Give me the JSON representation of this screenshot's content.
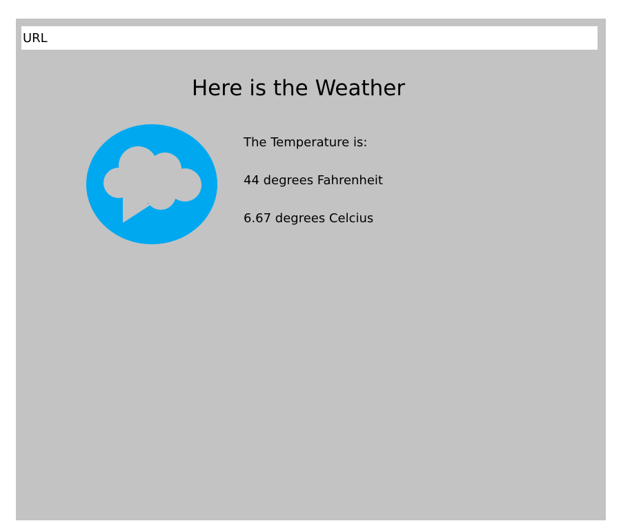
{
  "browser": {
    "url_placeholder": "URL"
  },
  "page": {
    "title": "Here is the Weather"
  },
  "icon": {
    "name": "cloud-speech-bubble-icon",
    "color": "#00a8f0"
  },
  "temperature": {
    "label": "The Temperature is:",
    "fahrenheit": "44 degrees Fahrenheit",
    "celsius": "6.67 degrees Celcius"
  },
  "colors": {
    "window_background": "#c3c3c3",
    "url_bar_background": "#ffffff",
    "icon_blue": "#00a8f0"
  }
}
